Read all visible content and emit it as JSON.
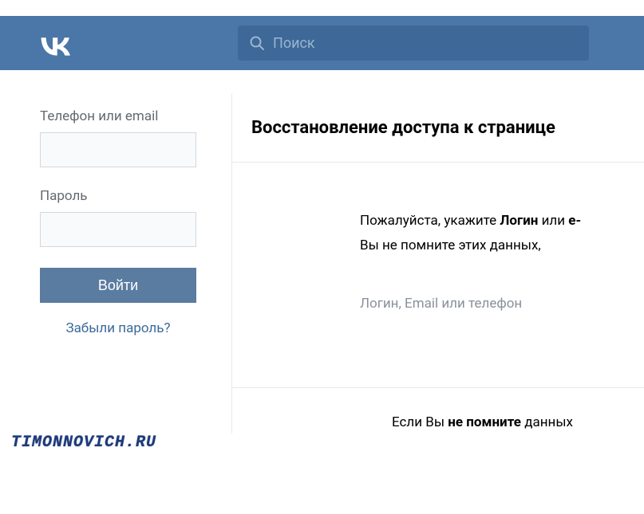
{
  "header": {
    "search_placeholder": "Поиск",
    "logo_name": "vk-logo"
  },
  "login": {
    "phone_label": "Телефон или email",
    "password_label": "Пароль",
    "login_button": "Войти",
    "forgot_link": "Забыли пароль?"
  },
  "recovery": {
    "title": "Восстановление доступа к странице",
    "hint_prefix": "Пожалуйста, укажите ",
    "hint_bold1": "Логин",
    "hint_mid": " или ",
    "hint_bold2": "e-",
    "hint_line2": "Вы не помните этих данных, ",
    "input_placeholder": "Логин, Email или телефон",
    "footer_prefix": "Если Вы ",
    "footer_bold": "не помните",
    "footer_suffix": " данных "
  },
  "watermark": "TIMONNOVICH.RU"
}
